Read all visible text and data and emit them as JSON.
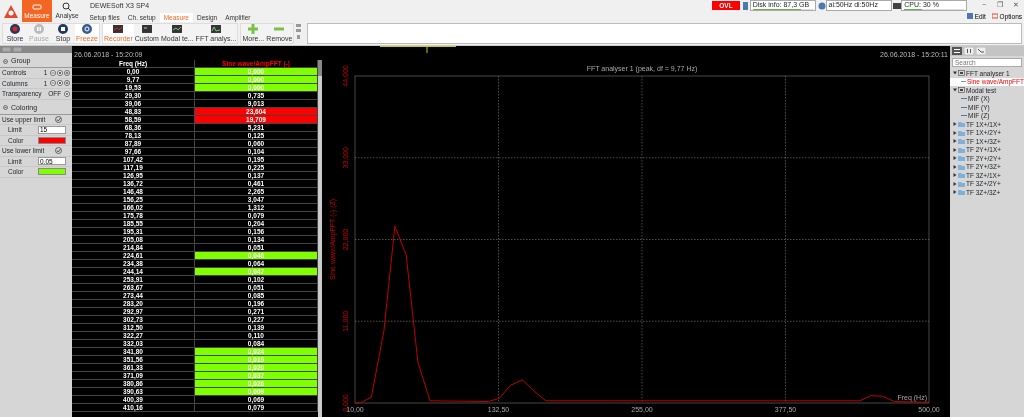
{
  "app": {
    "title": "DEWESoft X3 SP4",
    "modes": [
      {
        "label": "Measure",
        "kind": "measure",
        "selected": true
      },
      {
        "label": "Analyse",
        "kind": "analyse",
        "selected": false
      }
    ],
    "tabs": [
      {
        "label": "Setup files",
        "selected": false
      },
      {
        "label": "Ch. setup",
        "selected": false
      },
      {
        "label": "Measure",
        "selected": true
      },
      {
        "label": "Design",
        "selected": false
      },
      {
        "label": "Amplifier",
        "selected": false
      }
    ],
    "overload": "OVL",
    "meters": [
      {
        "label": "Disk info: 87,3 GB",
        "kind": "disk",
        "level": 0.8
      },
      {
        "label": "ai:50Hz di:50Hz",
        "kind": "sync"
      },
      {
        "label": "CPU: 30 %",
        "kind": "cpu",
        "level": 0.3
      }
    ],
    "window_buttons": [
      "−",
      "❐",
      "✕"
    ],
    "menu": [
      {
        "label": "Edit",
        "kind": "edit"
      },
      {
        "label": "Options",
        "kind": "options"
      }
    ]
  },
  "toolbar": [
    [
      {
        "label": "Store",
        "kind": "store",
        "disabled": false,
        "highlighted": false
      },
      {
        "label": "Pause",
        "kind": "pause",
        "disabled": true,
        "highlighted": false
      },
      {
        "label": "Stop",
        "kind": "stop",
        "disabled": false,
        "highlighted": false
      },
      {
        "label": "Freeze",
        "kind": "freeze",
        "disabled": false,
        "highlighted": true
      }
    ],
    [
      {
        "label": "Recorder",
        "kind": "recorder",
        "disabled": false,
        "highlighted": true
      },
      {
        "label": "Custom",
        "kind": "custom",
        "disabled": false,
        "highlighted": false
      },
      {
        "label": "Modal te...",
        "kind": "modal",
        "disabled": false,
        "highlighted": false
      },
      {
        "label": "FFT analys...",
        "kind": "fft",
        "disabled": false,
        "highlighted": false
      }
    ],
    [
      {
        "label": "More...",
        "kind": "more",
        "disabled": false,
        "highlighted": false
      },
      {
        "label": "Remove",
        "kind": "remove",
        "disabled": false,
        "highlighted": false
      }
    ]
  ],
  "time_bar": {
    "start": "26.06.2018 - 15:20:09",
    "end": "26.06.2018 - 15:20:11"
  },
  "properties": [
    {
      "title": "Group",
      "rows": [
        {
          "kind": "spinner",
          "label": "Controls",
          "value": "1"
        },
        {
          "kind": "spinner",
          "label": "Columns",
          "value": "1"
        },
        {
          "kind": "toggle",
          "label": "Transparency",
          "value": "OFF"
        }
      ]
    },
    {
      "title": "Coloring",
      "rows": [
        {
          "kind": "check",
          "label": "Use upper limit",
          "checked": true
        },
        {
          "kind": "input",
          "label": "Limit",
          "value": "15"
        },
        {
          "kind": "color",
          "label": "Color",
          "color": "#ff0000"
        },
        {
          "kind": "check",
          "label": "Use lower limit",
          "checked": true
        },
        {
          "kind": "input",
          "label": "Limit",
          "value": "0,05"
        },
        {
          "kind": "color",
          "label": "Color",
          "color": "#80ff00"
        }
      ]
    }
  ],
  "table": {
    "columns": [
      "Freq (Hz)",
      "Sine wave/AmpFFT (-)"
    ],
    "rows": [
      {
        "freq": "0,00",
        "value": "0,000",
        "above_upper": false,
        "below_lower": true
      },
      {
        "freq": "9,77",
        "value": "0,000",
        "above_upper": false,
        "below_lower": true
      },
      {
        "freq": "19,53",
        "value": "0,000",
        "above_upper": false,
        "below_lower": true
      },
      {
        "freq": "29,30",
        "value": "0,735",
        "above_upper": false,
        "below_lower": false
      },
      {
        "freq": "39,06",
        "value": "9,013",
        "above_upper": false,
        "below_lower": false
      },
      {
        "freq": "48,83",
        "value": "23,604",
        "above_upper": true,
        "below_lower": false
      },
      {
        "freq": "58,59",
        "value": "19,709",
        "above_upper": true,
        "below_lower": false
      },
      {
        "freq": "68,36",
        "value": "5,231",
        "above_upper": false,
        "below_lower": false
      },
      {
        "freq": "78,13",
        "value": "0,125",
        "above_upper": false,
        "below_lower": false
      },
      {
        "freq": "87,89",
        "value": "0,060",
        "above_upper": false,
        "below_lower": false
      },
      {
        "freq": "97,66",
        "value": "0,104",
        "above_upper": false,
        "below_lower": false
      },
      {
        "freq": "107,42",
        "value": "0,195",
        "above_upper": false,
        "below_lower": false
      },
      {
        "freq": "117,19",
        "value": "0,225",
        "above_upper": false,
        "below_lower": false
      },
      {
        "freq": "126,95",
        "value": "0,137",
        "above_upper": false,
        "below_lower": false
      },
      {
        "freq": "136,72",
        "value": "0,461",
        "above_upper": false,
        "below_lower": false
      },
      {
        "freq": "146,48",
        "value": "2,265",
        "above_upper": false,
        "below_lower": false
      },
      {
        "freq": "156,25",
        "value": "3,047",
        "above_upper": false,
        "below_lower": false
      },
      {
        "freq": "166,02",
        "value": "1,312",
        "above_upper": false,
        "below_lower": false
      },
      {
        "freq": "175,78",
        "value": "0,079",
        "above_upper": false,
        "below_lower": false
      },
      {
        "freq": "185,55",
        "value": "0,204",
        "above_upper": false,
        "below_lower": false
      },
      {
        "freq": "195,31",
        "value": "0,156",
        "above_upper": false,
        "below_lower": false
      },
      {
        "freq": "205,08",
        "value": "0,134",
        "above_upper": false,
        "below_lower": false
      },
      {
        "freq": "214,84",
        "value": "0,051",
        "above_upper": false,
        "below_lower": false
      },
      {
        "freq": "224,61",
        "value": "0,046",
        "above_upper": false,
        "below_lower": true
      },
      {
        "freq": "234,38",
        "value": "0,064",
        "above_upper": false,
        "below_lower": false
      },
      {
        "freq": "244,14",
        "value": "0,047",
        "above_upper": false,
        "below_lower": true
      },
      {
        "freq": "253,91",
        "value": "0,102",
        "above_upper": false,
        "below_lower": false
      },
      {
        "freq": "263,67",
        "value": "0,051",
        "above_upper": false,
        "below_lower": false
      },
      {
        "freq": "273,44",
        "value": "0,085",
        "above_upper": false,
        "below_lower": false
      },
      {
        "freq": "283,20",
        "value": "0,196",
        "above_upper": false,
        "below_lower": false
      },
      {
        "freq": "292,97",
        "value": "0,271",
        "above_upper": false,
        "below_lower": false
      },
      {
        "freq": "302,73",
        "value": "0,227",
        "above_upper": false,
        "below_lower": false
      },
      {
        "freq": "312,50",
        "value": "0,139",
        "above_upper": false,
        "below_lower": false
      },
      {
        "freq": "322,27",
        "value": "0,110",
        "above_upper": false,
        "below_lower": false
      },
      {
        "freq": "332,03",
        "value": "0,084",
        "above_upper": false,
        "below_lower": false
      },
      {
        "freq": "341,80",
        "value": "0,024",
        "above_upper": false,
        "below_lower": true
      },
      {
        "freq": "351,56",
        "value": "0,019",
        "above_upper": false,
        "below_lower": true
      },
      {
        "freq": "361,33",
        "value": "0,020",
        "above_upper": false,
        "below_lower": true
      },
      {
        "freq": "371,09",
        "value": "0,037",
        "above_upper": false,
        "below_lower": true
      },
      {
        "freq": "380,86",
        "value": "0,026",
        "above_upper": false,
        "below_lower": true
      },
      {
        "freq": "390,63",
        "value": "0,009",
        "above_upper": false,
        "below_lower": true
      },
      {
        "freq": "400,39",
        "value": "0,069",
        "above_upper": false,
        "below_lower": false
      },
      {
        "freq": "410,16",
        "value": "0,079",
        "above_upper": false,
        "below_lower": false
      }
    ]
  },
  "chart": {
    "chart_data": {
      "type": "line",
      "title": "FFT analyser 1 (peak, df = 9,77 Hz)",
      "xlabel": "Freq (Hz)",
      "ylabel": "Sine wave/AmpFFT (-) (Z)",
      "x": [
        10,
        14.4,
        24,
        34.7,
        44.1,
        53.7,
        63.7,
        74,
        123.7,
        133,
        142.8,
        153,
        162.9,
        173,
        229.5,
        441,
        450.4,
        460.6,
        470.5,
        500
      ],
      "series": [
        {
          "color": "#c00000",
          "values": [
            0,
            0,
            0.8,
            9.7,
            23.8,
            19.9,
            5.5,
            0.3,
            0.2,
            0.6,
            2.4,
            3.1,
            1.6,
            0.3,
            0.3,
            0.3,
            1.0,
            0.9,
            0.2,
            0.1
          ]
        }
      ],
      "xlim": [
        10,
        500
      ],
      "ylim": [
        0,
        44
      ],
      "grid": true,
      "xticks": [
        {
          "value": 10,
          "label": "10,00"
        },
        {
          "value": 132.5,
          "label": "132,50"
        },
        {
          "value": 255,
          "label": "255,00"
        },
        {
          "value": 377.5,
          "label": "377,50"
        },
        {
          "value": 500,
          "label": "500,00"
        }
      ],
      "yticks": [
        {
          "value": 0,
          "label": "0,000"
        },
        {
          "value": 11,
          "label": "11,000"
        },
        {
          "value": 22,
          "label": "22,000"
        },
        {
          "value": 33,
          "label": "33,000"
        },
        {
          "value": 44,
          "label": "44,000"
        }
      ]
    }
  },
  "channels": {
    "search": {
      "placeholder": "Search"
    },
    "tree": [
      {
        "kind": "group",
        "label": "FFT analyser 1",
        "expanded": true,
        "children": [
          {
            "kind": "channel",
            "label": "Sine wave/AmpFFT",
            "selected": true
          }
        ]
      },
      {
        "kind": "group",
        "label": "Modal test",
        "expanded": true,
        "children": [
          {
            "kind": "channel",
            "label": "MIF (X)",
            "selected": false
          },
          {
            "kind": "channel",
            "label": "MIF (Y)",
            "selected": false
          },
          {
            "kind": "channel",
            "label": "MIF (Z)",
            "selected": false
          }
        ]
      },
      {
        "kind": "folder",
        "label": "TF 1X+/1X+",
        "expanded": false
      },
      {
        "kind": "folder",
        "label": "TF 1X+/2Y+",
        "expanded": false
      },
      {
        "kind": "folder",
        "label": "TF 1X+/3Z+",
        "expanded": false
      },
      {
        "kind": "folder",
        "label": "TF 2Y+/1X+",
        "expanded": false
      },
      {
        "kind": "folder",
        "label": "TF 2Y+/2Y+",
        "expanded": false
      },
      {
        "kind": "folder",
        "label": "TF 2Y+/3Z+",
        "expanded": false
      },
      {
        "kind": "folder",
        "label": "TF 3Z+/1X+",
        "expanded": false
      },
      {
        "kind": "folder",
        "label": "TF 3Z+/2Y+",
        "expanded": false
      },
      {
        "kind": "folder",
        "label": "TF 3Z+/3Z+",
        "expanded": false
      }
    ]
  }
}
